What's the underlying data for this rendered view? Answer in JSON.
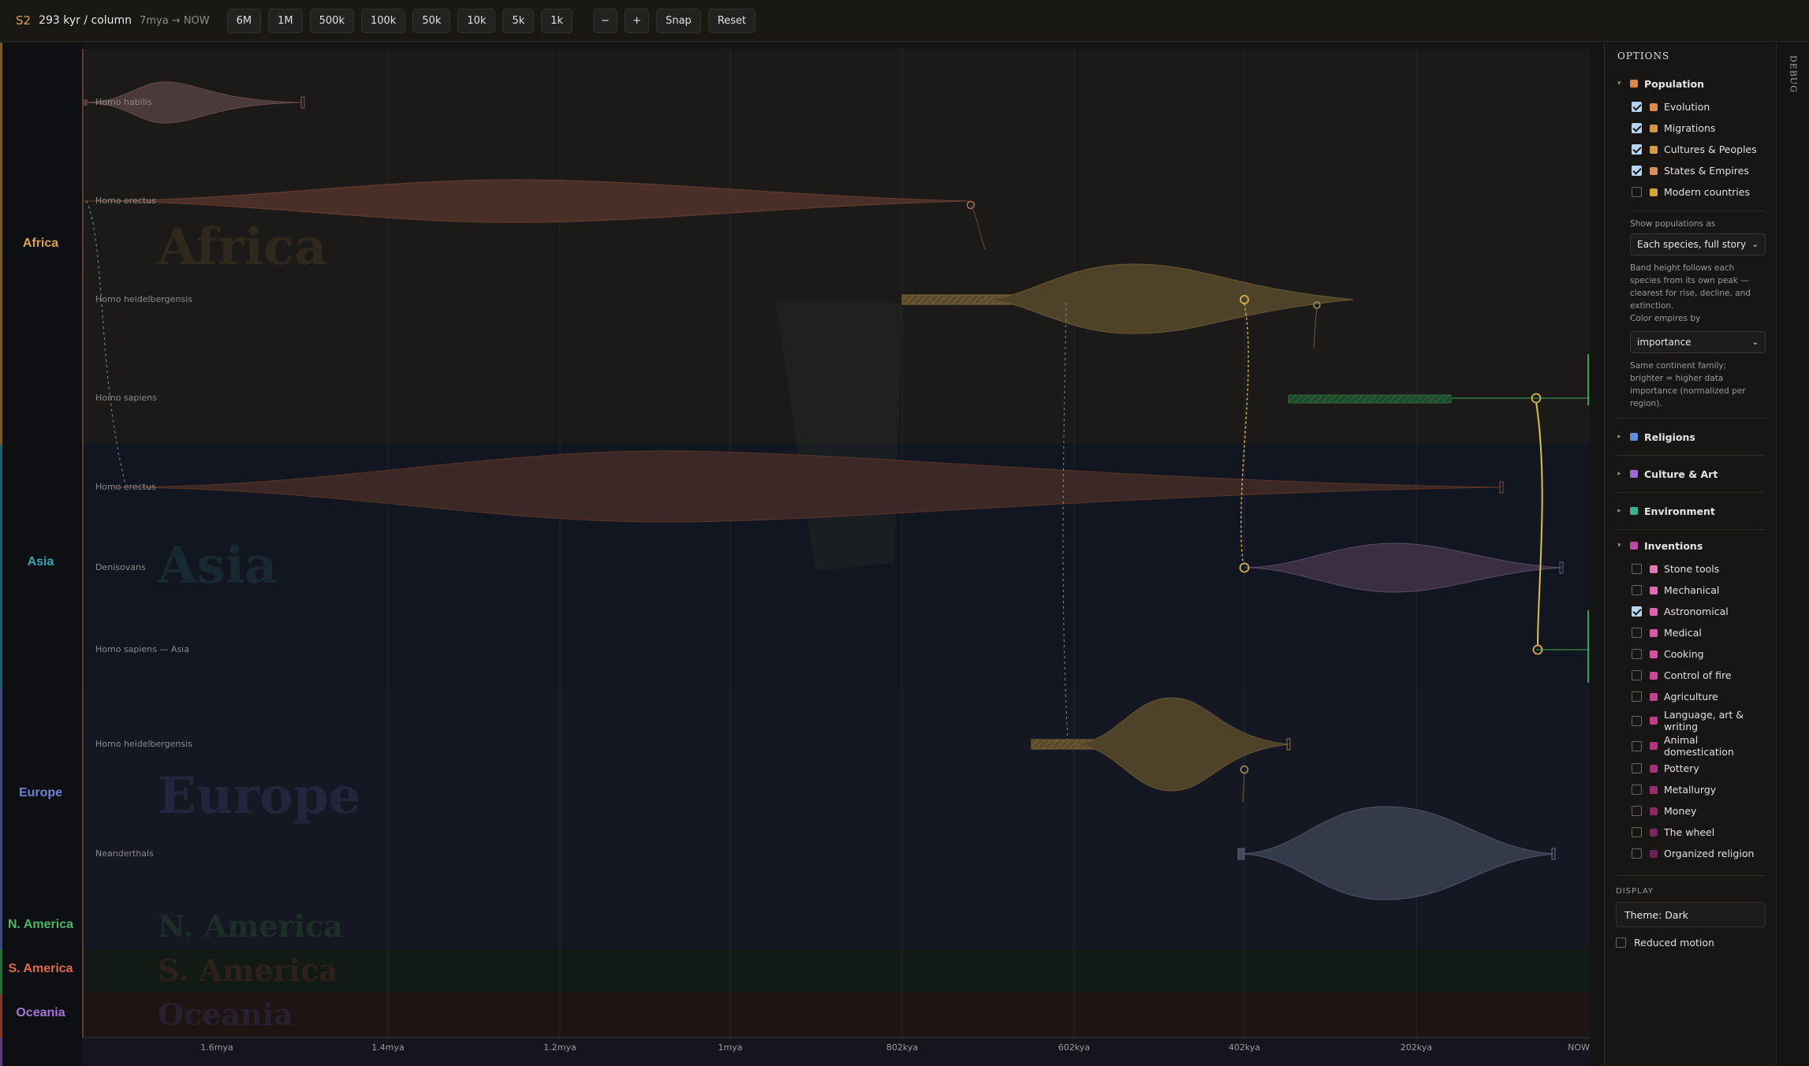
{
  "toolbar": {
    "logo": "S2",
    "scale": "293 kyr / column",
    "range": "7mya → NOW",
    "zoom_buttons": [
      "6M",
      "1M",
      "500k",
      "100k",
      "50k",
      "10k",
      "5k",
      "1k"
    ],
    "minus": "−",
    "plus": "+",
    "snap": "Snap",
    "reset": "Reset"
  },
  "regions": [
    {
      "name": "Africa",
      "color": "#d9a04e"
    },
    {
      "name": "Asia",
      "color": "#3aa5b5"
    },
    {
      "name": "Europe",
      "color": "#6a82d2"
    },
    {
      "name": "N. America",
      "color": "#4fb36b"
    },
    {
      "name": "S. America",
      "color": "#e0694a"
    },
    {
      "name": "Oceania",
      "color": "#a774d8"
    }
  ],
  "rows": [
    {
      "label": "Homo habilis"
    },
    {
      "label": "Homo erectus"
    },
    {
      "label": "Homo heidelbergensis"
    },
    {
      "label": "Homo sapiens"
    },
    {
      "label": "Homo erectus"
    },
    {
      "label": "Denisovans"
    },
    {
      "label": "Homo sapiens — Asia"
    },
    {
      "label": "Homo heidelbergensis"
    },
    {
      "label": "Neanderthals"
    }
  ],
  "axis": {
    "ticks": [
      "1.6mya",
      "1.4mya",
      "1.2mya",
      "1mya",
      "802kya",
      "602kya",
      "402kya",
      "202kya",
      "NOW"
    ]
  },
  "options": {
    "title": "OPTIONS",
    "population": {
      "label": "Population",
      "color": "#d98a4a",
      "items": [
        {
          "label": "Evolution",
          "checked": true,
          "color": "#d98a4a"
        },
        {
          "label": "Migrations",
          "checked": true,
          "color": "#d59548"
        },
        {
          "label": "Cultures & Peoples",
          "checked": true,
          "color": "#d19d46"
        },
        {
          "label": "States & Empires",
          "checked": true,
          "color": "#d98e60"
        },
        {
          "label": "Modern countries",
          "checked": false,
          "color": "#d4a33a"
        }
      ],
      "show_as_label": "Show populations as",
      "show_as_value": "Each species, full story",
      "show_as_help": "Band height follows each species from its own peak — clearest for rise, decline, and extinction.",
      "color_by_label": "Color empires by",
      "color_by_value": "importance",
      "color_by_help": "Same continent family; brighter = higher data importance (normalized per region)."
    },
    "sections": [
      {
        "label": "Religions",
        "color": "#5b8fd6"
      },
      {
        "label": "Culture & Art",
        "color": "#9b6ad0"
      },
      {
        "label": "Environment",
        "color": "#3fb08f"
      }
    ],
    "inventions": {
      "label": "Inventions",
      "color": "#c04aa0",
      "items": [
        {
          "label": "Stone tools",
          "checked": false,
          "color": "#e07ab8"
        },
        {
          "label": "Mechanical",
          "checked": false,
          "color": "#dc6fb2"
        },
        {
          "label": "Astronomical",
          "checked": true,
          "color": "#d865ac"
        },
        {
          "label": "Medical",
          "checked": false,
          "color": "#d45ca6"
        },
        {
          "label": "Cooking",
          "checked": false,
          "color": "#d052a0"
        },
        {
          "label": "Control of fire",
          "checked": false,
          "color": "#c84899"
        },
        {
          "label": "Agriculture",
          "checked": false,
          "color": "#c24292"
        },
        {
          "label": "Language, art & writing",
          "checked": false,
          "color": "#ba3c8a"
        },
        {
          "label": "Animal domestication",
          "checked": false,
          "color": "#b03682"
        },
        {
          "label": "Pottery",
          "checked": false,
          "color": "#a4327a"
        },
        {
          "label": "Metallurgy",
          "checked": false,
          "color": "#962e70"
        },
        {
          "label": "Money",
          "checked": false,
          "color": "#882a66"
        },
        {
          "label": "The wheel",
          "checked": false,
          "color": "#7a265c"
        },
        {
          "label": "Organized religion",
          "checked": false,
          "color": "#6c2252"
        }
      ]
    },
    "display": {
      "title": "DISPLAY",
      "theme": "Theme: Dark",
      "reduced_motion": "Reduced motion",
      "reduced_motion_checked": false
    }
  },
  "debug_tab": "DEBUG"
}
